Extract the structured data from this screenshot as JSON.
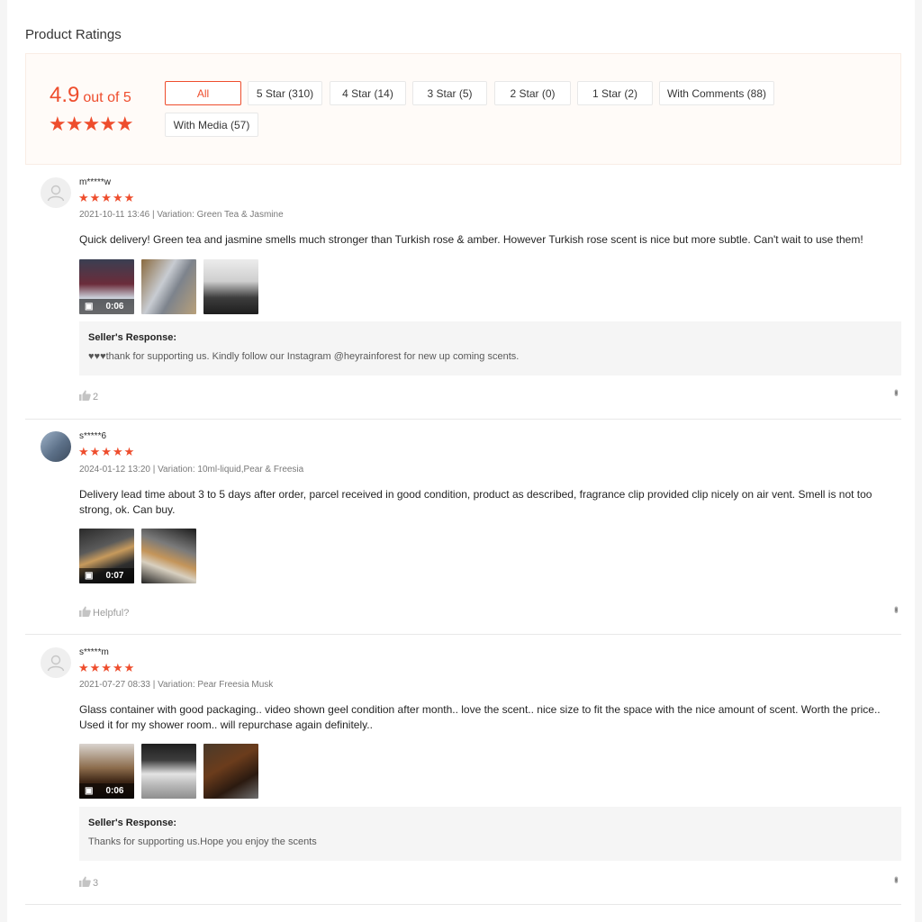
{
  "section_title": "Product Ratings",
  "overview": {
    "score": "4.9",
    "score_suffix": "out of 5",
    "stars": "★★★★★",
    "rating_value": 4.9,
    "filters": [
      {
        "label": "All",
        "active": true
      },
      {
        "label": "5 Star (310)",
        "active": false
      },
      {
        "label": "4 Star (14)",
        "active": false
      },
      {
        "label": "3 Star (5)",
        "active": false
      },
      {
        "label": "2 Star (0)",
        "active": false
      },
      {
        "label": "1 Star (2)",
        "active": false
      },
      {
        "label": "With Comments (88)",
        "active": false
      },
      {
        "label": "With Media (57)",
        "active": false
      }
    ]
  },
  "reviews": [
    {
      "username": "m*****w",
      "stars": "★★★★★",
      "rating": 5,
      "meta": "2021-10-11 13:46 | Variation: Green Tea & Jasmine",
      "comment": "Quick delivery! Green tea and jasmine smells much stronger than Turkish rose & amber. However Turkish rose scent is nice but more subtle. Can't wait to use them!",
      "video_duration": "0:06",
      "seller_response_label": "Seller's Response:",
      "seller_response": "♥♥♥thank for supporting us. Kindly follow our Instagram @heyrainforest for new up coming scents.",
      "likes": "2"
    },
    {
      "username": "s*****6",
      "stars": "★★★★★",
      "rating": 5,
      "meta": "2024-01-12 13:20 | Variation: 10ml-liquid,Pear & Freesia",
      "comment": "Delivery lead time about 3 to 5 days after order, parcel received in good condition, product as described, fragrance clip provided clip nicely on air vent. Smell is not too strong, ok. Can buy.",
      "video_duration": "0:07",
      "likes": "Helpful?"
    },
    {
      "username": "s*****m",
      "stars": "★★★★★",
      "rating": 5,
      "meta": "2021-07-27 08:33 | Variation: Pear Freesia Musk",
      "comment": "Glass container with good packaging.. video shown geel condition after month.. love the scent.. nice size to fit the space with the nice amount of scent. Worth the price..  Used it for my shower room.. will repurchase again definitely..",
      "video_duration": "0:06",
      "seller_response_label": "Seller's Response:",
      "seller_response": "Thanks for supporting us.Hope you enjoy the scents",
      "likes": "3"
    }
  ],
  "colors": {
    "accent": "#ee4d2d",
    "overview_bg": "#fffbf8",
    "response_bg": "#f5f5f5"
  }
}
